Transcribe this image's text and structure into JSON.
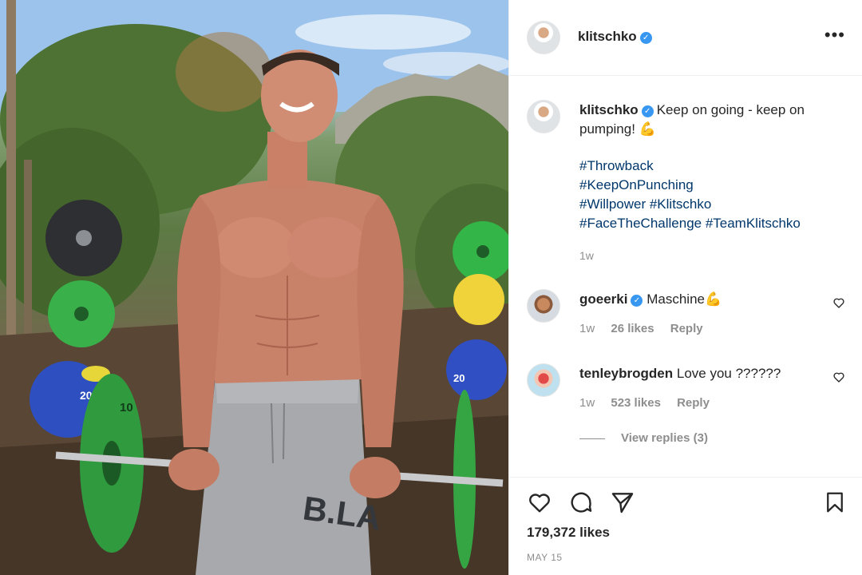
{
  "post": {
    "username": "klitschko",
    "verified_icon": "verified-badge-icon",
    "more_icon": "more-options-icon",
    "more_label": "•••"
  },
  "caption": {
    "username": "klitschko",
    "text": "Keep on going - keep on pumping! 💪",
    "hashtag_lines": [
      "#Throwback",
      "#KeepOnPunching",
      "#Willpower #Klitschko",
      "#FaceTheChallenge #TeamKlitschko"
    ],
    "time": "1w"
  },
  "comments": [
    {
      "username": "goeerki",
      "verified": true,
      "text": "Maschine💪",
      "time": "1w",
      "likes": "26 likes",
      "reply": "Reply"
    },
    {
      "username": "tenleybrogden",
      "verified": false,
      "text": "Love you ??????",
      "time": "1w",
      "likes": "523 likes",
      "reply": "Reply"
    }
  ],
  "view_replies": "View replies (3)",
  "actions": {
    "icons": [
      "heart-icon",
      "comment-icon",
      "share-icon",
      "bookmark-icon"
    ]
  },
  "likes": "179,372 likes",
  "date": "MAY 15",
  "photo_text": {
    "weight_10": "10",
    "weight_20": "20",
    "shorts_print": "B.LA"
  },
  "colors": {
    "link": "#00376b",
    "verified": "#3897f0",
    "muted": "#8e8e8e",
    "text": "#262626"
  }
}
